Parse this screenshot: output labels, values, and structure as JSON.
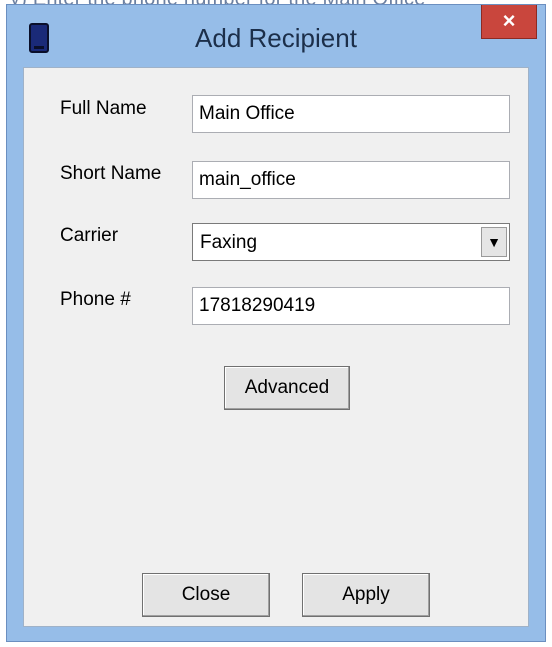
{
  "background": {
    "partial_text": "y) Enter the phone number for the Main Office"
  },
  "window": {
    "title": "Add Recipient",
    "close_glyph": "×",
    "icon": "phone-icon",
    "colors": {
      "frame": "#96bde8",
      "close_button": "#c9463d",
      "client_area": "#f0f0f0"
    }
  },
  "form": {
    "full_name": {
      "label": "Full Name",
      "value": "Main Office"
    },
    "short_name": {
      "label": "Short Name",
      "value": "main_office"
    },
    "carrier": {
      "label": "Carrier",
      "value": "Faxing",
      "arrow_glyph": "▼"
    },
    "phone": {
      "label": "Phone #",
      "value": "17818290419"
    }
  },
  "buttons": {
    "advanced": "Advanced",
    "close": "Close",
    "apply": "Apply"
  }
}
